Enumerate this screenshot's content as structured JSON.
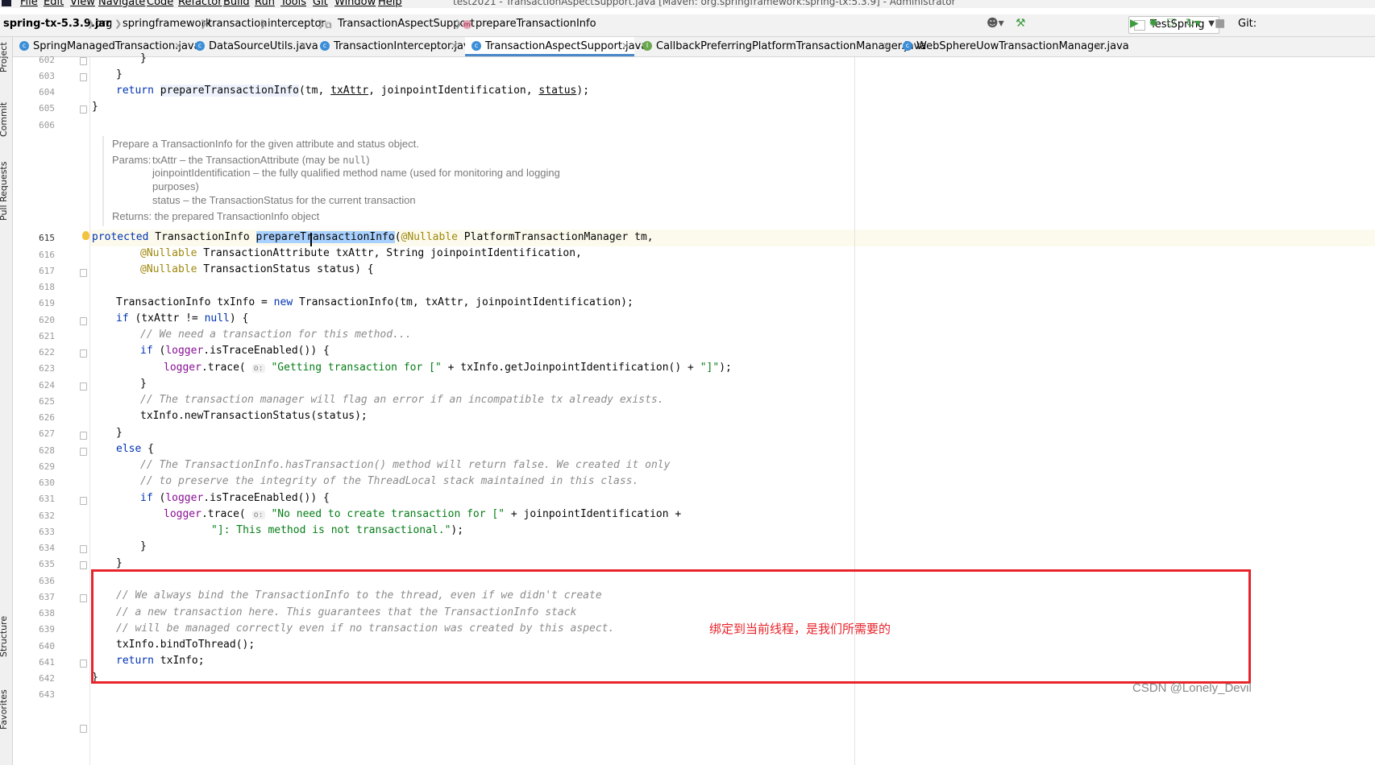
{
  "window": {
    "title": "test2021 - TransactionAspectSupport.java [Maven: org.springframework:spring-tx:5.3.9] - Administrator",
    "menu": [
      "File",
      "Edit",
      "View",
      "Navigate",
      "Code",
      "Refactor",
      "Build",
      "Run",
      "Tools",
      "Git",
      "Window",
      "Help"
    ]
  },
  "breadcrumb": {
    "jar": "spring-tx-5.3.9.jar",
    "items": [
      "org",
      "springframework",
      "transaction",
      "interceptor"
    ],
    "class": "TransactionAspectSupport",
    "method": "prepareTransactionInfo"
  },
  "toolbar": {
    "run_config": "TestSpring",
    "git_label": "Git:"
  },
  "tabs": [
    {
      "label": "SpringManagedTransaction.java",
      "kind": "class",
      "active": false
    },
    {
      "label": "DataSourceUtils.java",
      "kind": "class",
      "active": false
    },
    {
      "label": "TransactionInterceptor.java",
      "kind": "class",
      "active": false
    },
    {
      "label": "TransactionAspectSupport.java",
      "kind": "class",
      "active": true
    },
    {
      "label": "CallbackPreferringPlatformTransactionManager.java",
      "kind": "interface",
      "active": false
    },
    {
      "label": "WebSphereUowTransactionManager.java",
      "kind": "class",
      "active": false
    }
  ],
  "tool_windows": [
    "Project",
    "Commit",
    "Pull Requests",
    "Structure",
    "Favorites"
  ],
  "javadoc": {
    "summary": "Prepare a TransactionInfo for the given attribute and status object.",
    "params_label": "Params:",
    "param1": "txAttr – the TransactionAttribute (may be ",
    "param1_null": "null",
    "param1_end": ")",
    "param2_a": "joinpointIdentification – the fully qualified method name (used for monitoring and logging",
    "param2_b": "purposes)",
    "param3": "status – the TransactionStatus for the current transaction",
    "returns": "Returns: the prepared TransactionInfo object"
  },
  "line_numbers": {
    "top": [
      "602",
      "603",
      "604",
      "605",
      "606"
    ],
    "bottom": [
      "615",
      "616",
      "617",
      "618",
      "619",
      "620",
      "621",
      "622",
      "623",
      "624",
      "625",
      "626",
      "627",
      "628",
      "629",
      "630",
      "631",
      "632",
      "633",
      "634",
      "635",
      "636",
      "637",
      "638",
      "639",
      "640",
      "641",
      "642",
      "643"
    ]
  },
  "code": {
    "l602": "}",
    "l603": "}",
    "l604_kw": "return",
    "l604_a": "prepareTransactionInfo",
    "l604_b": "(tm, ",
    "l604_c": "txAttr",
    "l604_d": ", joinpointIdentification, ",
    "l604_e": "status",
    "l604_f": ");",
    "l605": "}",
    "l615_kw": "protected",
    "l615_a": " TransactionInfo ",
    "l615_sel1": "prepareTran",
    "l615_sel2": "sactionInfo",
    "l615_b": "(",
    "l615_an": "@Nullable",
    "l615_c": " PlatformTransactionManager tm,",
    "l616_an": "@Nullable",
    "l616_a": " TransactionAttribute txAttr, String joinpointIdentification,",
    "l617_an": "@Nullable",
    "l617_a": " TransactionStatus status) {",
    "l619_a": "TransactionInfo txInfo = ",
    "l619_kw": "new",
    "l619_b": " TransactionInfo(tm, txAttr, joinpointIdentification);",
    "l620_kw": "if",
    "l620_a": " (txAttr != ",
    "l620_kw2": "null",
    "l620_b": ") {",
    "l621_cm": "// We need a transaction for this method...",
    "l622_kw": "if",
    "l622_a": " (",
    "l622_fld": "logger",
    "l622_b": ".isTraceEnabled()) {",
    "l623_fld": "logger",
    "l623_a": ".trace( ",
    "l623_hint": "o:",
    "l623_st": " \"Getting transaction for [\"",
    "l623_b": " + txInfo.getJoinpointIdentification() + ",
    "l623_st2": "\"]\"",
    "l623_c": ");",
    "l624": "}",
    "l625_cm": "// The transaction manager will flag an error if an incompatible tx already exists.",
    "l626": "txInfo.newTransactionStatus(status);",
    "l627": "}",
    "l628_kw": "else",
    "l628_a": " {",
    "l629_cm": "// The TransactionInfo.hasTransaction() method will return false. We created it only",
    "l630_cm": "// to preserve the integrity of the ThreadLocal stack maintained in this class.",
    "l631_kw": "if",
    "l631_a": " (",
    "l631_fld": "logger",
    "l631_b": ".isTraceEnabled()) {",
    "l632_fld": "logger",
    "l632_a": ".trace( ",
    "l632_hint": "o:",
    "l632_st": " \"No need to create transaction for [\"",
    "l632_b": " + joinpointIdentification +",
    "l633_st": "\"]: This method is not transactional.\"",
    "l633_a": ");",
    "l634": "}",
    "l635": "}",
    "l637_cm": "// We always bind the TransactionInfo to the thread, even if we didn't create",
    "l638_cm": "// a new transaction here. This guarantees that the TransactionInfo stack",
    "l639_cm": "// will be managed correctly even if no transaction was created by this aspect.",
    "l640": "txInfo.bindToThread();",
    "l641_kw": "return",
    "l641_a": " txInfo;",
    "l642": "}"
  },
  "annotation": {
    "note": "绑定到当前线程，是我们所需要的",
    "watermark": "CSDN @Lonely_Devil",
    "box_color": "#e8242b"
  }
}
